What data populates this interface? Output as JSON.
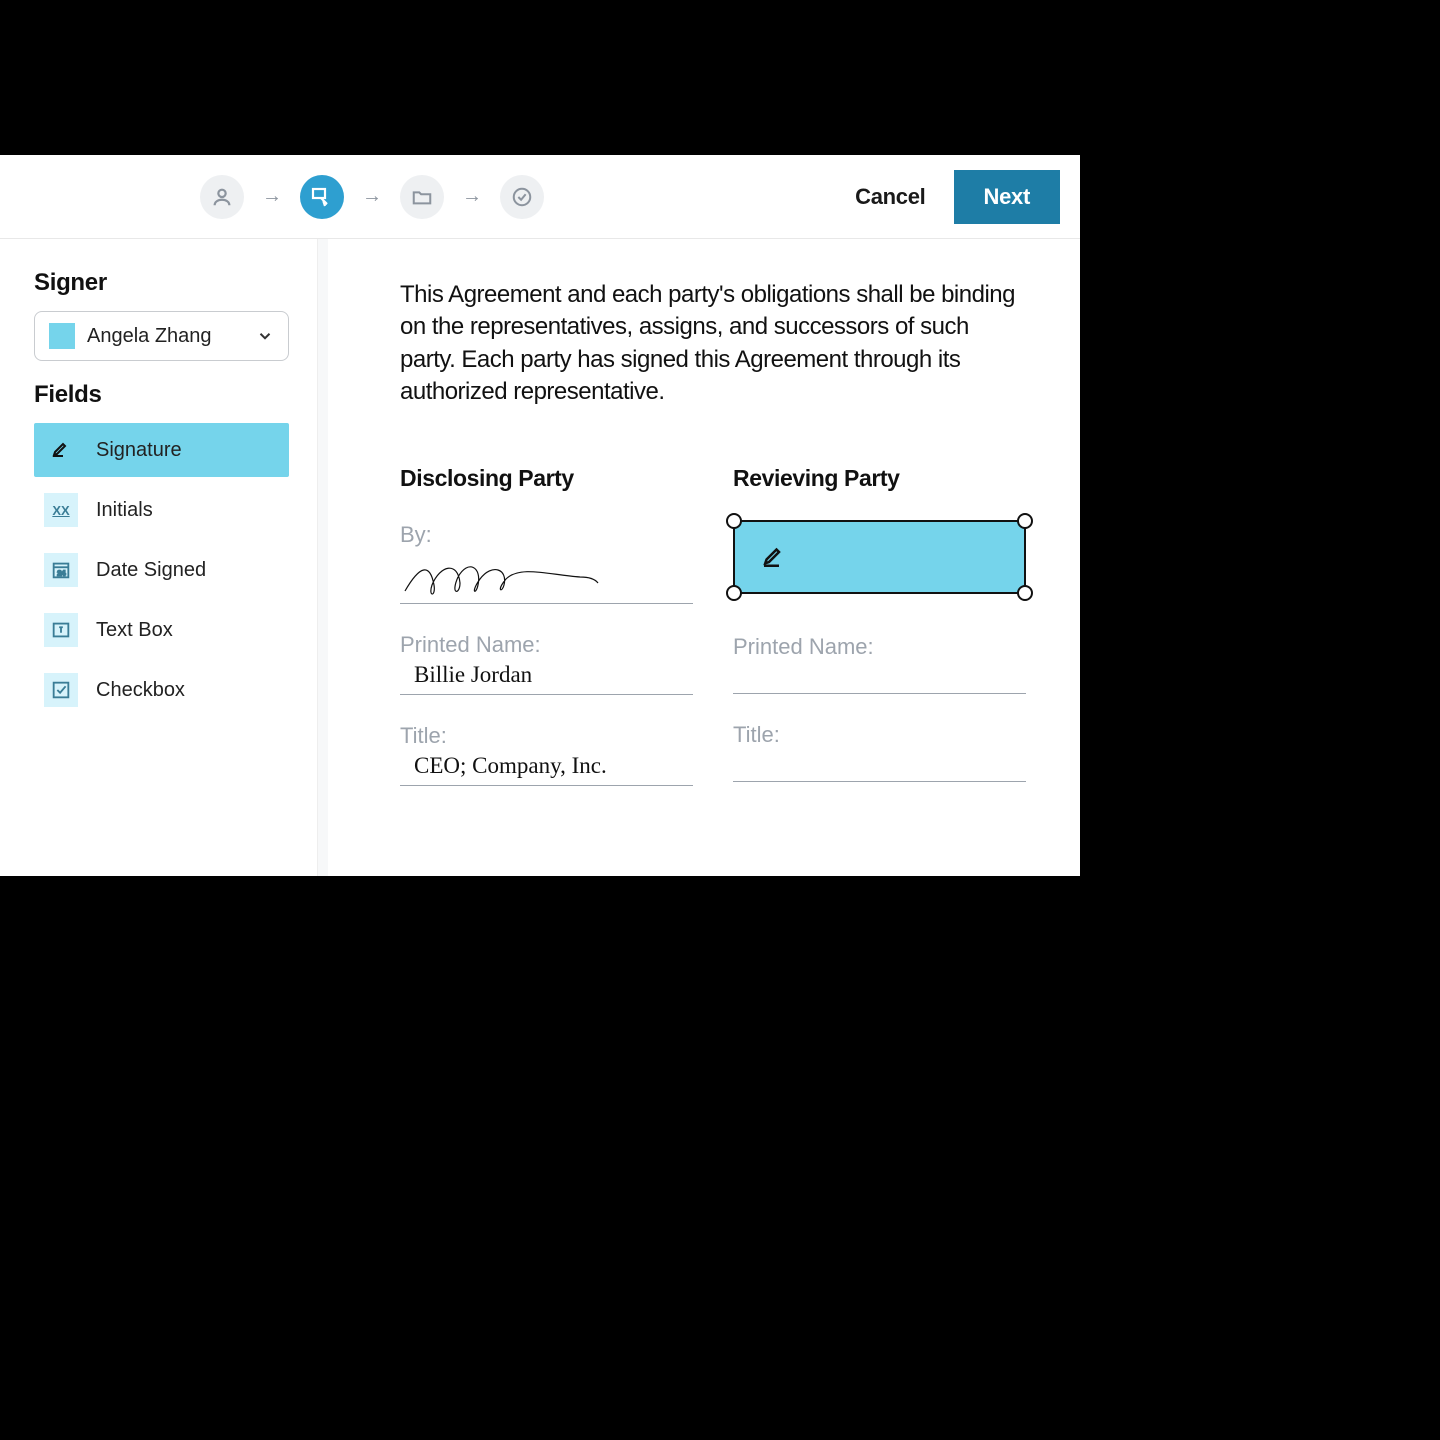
{
  "header": {
    "cancel_label": "Cancel",
    "next_label": "Next"
  },
  "sidebar": {
    "signer_title": "Signer",
    "fields_title": "Fields",
    "selected_signer": "Angela Zhang",
    "fields": [
      {
        "label": "Signature"
      },
      {
        "label": "Initials"
      },
      {
        "label": "Date Signed"
      },
      {
        "label": "Text Box"
      },
      {
        "label": "Checkbox"
      }
    ]
  },
  "document": {
    "paragraph": "This Agreement and each party's obligations shall be binding on the representatives, assigns, and successors of such party. Each party has signed this Agreement through its authorized representative.",
    "disclosing": {
      "title": "Disclosing Party",
      "by_label": "By:",
      "printed_label": "Printed Name:",
      "printed_value": "Billie Jordan",
      "title_label": "Title:",
      "title_value": "CEO; Company, Inc."
    },
    "reviewing": {
      "title": "Revieving Party",
      "printed_label": "Printed Name:",
      "title_label": "Title:"
    }
  }
}
